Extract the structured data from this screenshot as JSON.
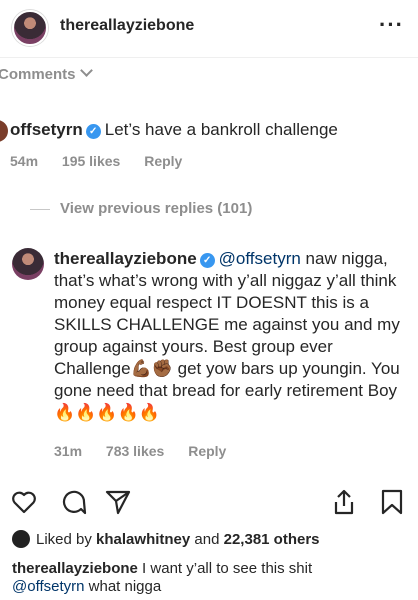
{
  "header": {
    "username": "thereallayziebone",
    "more_label": "···"
  },
  "comments_toggle": "Comments",
  "comment1": {
    "username": "offsetyrn",
    "text": "Let’s have a bankroll challenge",
    "time": "54m",
    "likes": "195 likes",
    "reply": "Reply"
  },
  "view_previous": "View previous replies (101)",
  "reply": {
    "username": "thereallayziebone",
    "mention": "@offsetyrn",
    "text_part1": " naw nigga, that’s what’s wrong with y’all niggaz y’all think money equal respect IT DOESNT this is a SKILLS CHALLENGE me against you and my group against yours. Best group ever Challenge",
    "emoji1": "💪🏾",
    "emoji2": "✊🏾",
    "text_part2": " get yow bars up youngin. You gone need that bread for early retirement Boy",
    "emoji_fire": "🔥🔥🔥🔥🔥",
    "time": "31m",
    "likes": "783 likes",
    "reply_label": "Reply"
  },
  "likes_line": {
    "prefix": "Liked by ",
    "liker": "khalawhitney",
    "middle": " and ",
    "count": "22,381 others"
  },
  "caption": {
    "username": "thereallayziebone",
    "text": " I want y’all to see this shit",
    "mention": "@offsetyrn",
    "text2": " what nigga"
  }
}
